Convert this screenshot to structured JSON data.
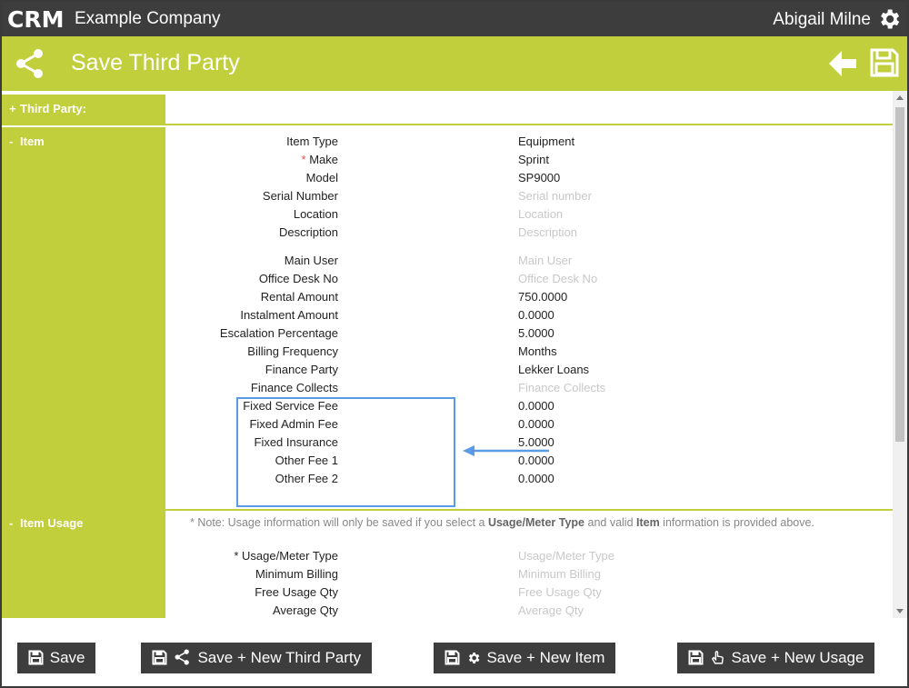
{
  "app": {
    "logo_text": "CRM",
    "company": "Example Company",
    "user": "Abigail Milne"
  },
  "header": {
    "title": "Save Third Party"
  },
  "sections": {
    "third_party": {
      "sign": "+",
      "label": "Third Party:"
    },
    "item": {
      "sign": "-",
      "label": "Item"
    },
    "item_usage": {
      "sign": "-",
      "label": "Item Usage"
    }
  },
  "item_fields": [
    {
      "label": "Item Type",
      "value": "Equipment",
      "placeholder": false,
      "required": false
    },
    {
      "label": "Make",
      "value": "Sprint",
      "placeholder": false,
      "required": true
    },
    {
      "label": "Model",
      "value": "SP9000",
      "placeholder": false,
      "required": false
    },
    {
      "label": "Serial Number",
      "value": "Serial number",
      "placeholder": true,
      "required": false
    },
    {
      "label": "Location",
      "value": "Location",
      "placeholder": true,
      "required": false
    },
    {
      "label": "Description",
      "value": "Description",
      "placeholder": true,
      "required": false
    },
    {
      "label": "Main User",
      "value": "Main User",
      "placeholder": true,
      "required": false
    },
    {
      "label": "Office Desk No",
      "value": "Office Desk No",
      "placeholder": true,
      "required": false
    },
    {
      "label": "Rental Amount",
      "value": "750.0000",
      "placeholder": false,
      "required": false
    },
    {
      "label": "Instalment Amount",
      "value": "0.0000",
      "placeholder": false,
      "required": false
    },
    {
      "label": "Escalation Percentage",
      "value": "5.0000",
      "placeholder": false,
      "required": false
    },
    {
      "label": "Billing Frequency",
      "value": "Months",
      "placeholder": false,
      "required": false
    },
    {
      "label": "Finance Party",
      "value": "Lekker Loans",
      "placeholder": false,
      "required": false
    },
    {
      "label": "Finance Collects",
      "value": "Finance Collects",
      "placeholder": true,
      "required": false
    },
    {
      "label": "Fixed Service Fee",
      "value": "0.0000",
      "placeholder": false,
      "required": false
    },
    {
      "label": "Fixed Admin Fee",
      "value": "0.0000",
      "placeholder": false,
      "required": false
    },
    {
      "label": "Fixed Insurance",
      "value": "5.0000",
      "placeholder": false,
      "required": false
    },
    {
      "label": "Other Fee 1",
      "value": "0.0000",
      "placeholder": false,
      "required": false
    },
    {
      "label": "Other Fee 2",
      "value": "0.0000",
      "placeholder": false,
      "required": false
    }
  ],
  "usage_note": {
    "prefix": "* Note: Usage information will only be saved if you select a ",
    "bold1": "Usage/Meter Type",
    "middle": " and valid ",
    "bold2": "Item",
    "suffix": " information is provided above."
  },
  "usage_fields": [
    {
      "label": "Usage/Meter Type",
      "value": "Usage/Meter Type",
      "placeholder": true,
      "required": true
    },
    {
      "label": "Minimum Billing",
      "value": "Minimum Billing",
      "placeholder": true,
      "required": false
    },
    {
      "label": "Free Usage Qty",
      "value": "Free Usage Qty",
      "placeholder": true,
      "required": false
    },
    {
      "label": "Average Qty",
      "value": "Average Qty",
      "placeholder": true,
      "required": false
    }
  ],
  "footer": {
    "save": "Save",
    "save_new_third_party": "Save + New Third Party",
    "save_new_item": "Save + New Item",
    "save_new_usage": "Save + New Usage"
  },
  "colors": {
    "accent": "#c2cf3c",
    "dark": "#3d3d3d",
    "highlight": "#5a9be6"
  }
}
